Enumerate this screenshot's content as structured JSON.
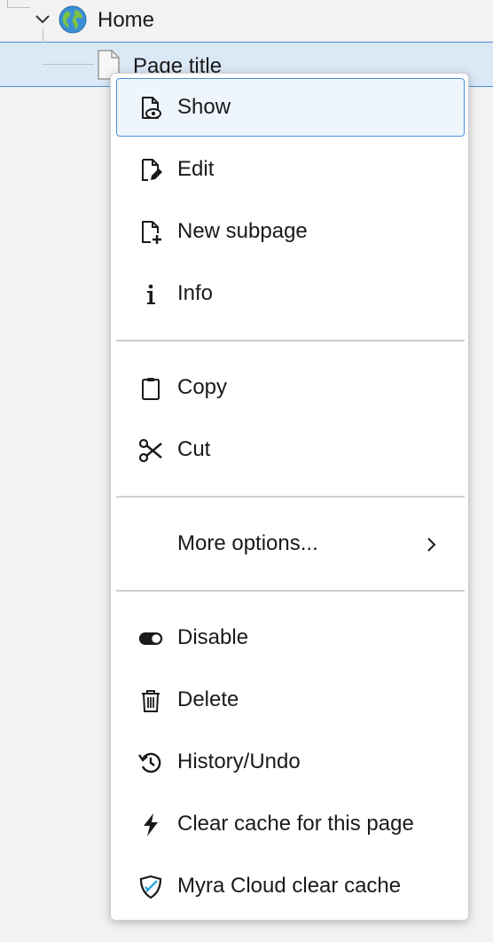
{
  "tree": {
    "home": {
      "label": "Home",
      "icon": "globe-icon"
    },
    "page": {
      "label": "Page title",
      "icon": "page-icon"
    }
  },
  "menu": {
    "groups": [
      {
        "items": [
          {
            "label": "Show",
            "icon": "show-eye-document-icon",
            "active": true
          },
          {
            "label": "Edit",
            "icon": "edit-document-icon"
          },
          {
            "label": "New subpage",
            "icon": "new-document-icon"
          },
          {
            "label": "Info",
            "icon": "info-icon"
          }
        ]
      },
      {
        "items": [
          {
            "label": "Copy",
            "icon": "clipboard-icon"
          },
          {
            "label": "Cut",
            "icon": "scissors-icon"
          }
        ]
      },
      {
        "items": [
          {
            "label": "More options...",
            "icon": "chevron-right-icon"
          }
        ]
      },
      {
        "items": [
          {
            "label": "Disable",
            "icon": "toggle-icon"
          },
          {
            "label": "Delete",
            "icon": "trash-icon"
          },
          {
            "label": "History/Undo",
            "icon": "history-icon"
          },
          {
            "label": "Clear cache for this page",
            "icon": "lightning-icon"
          },
          {
            "label": "Myra Cloud clear cache",
            "icon": "shield-icon"
          }
        ]
      }
    ]
  },
  "colors": {
    "accent": "#4a90d9",
    "selected_bg": "#dbe8f6",
    "active_item_bg": "#eef5fd",
    "shield_accent": "#2aa7d9"
  }
}
